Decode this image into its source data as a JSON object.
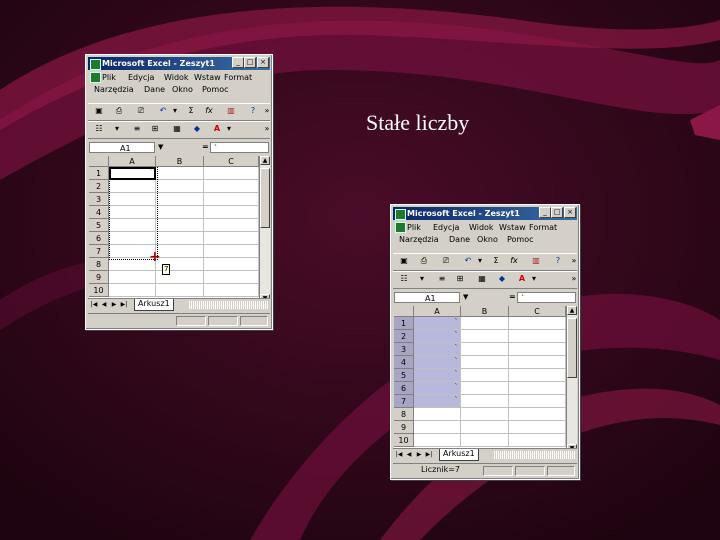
{
  "slide": {
    "title": "Stałe liczby"
  },
  "colors": {
    "background": "#2a0616",
    "swoosh": "#8a1745",
    "selection": "#b8b8dc",
    "titlebar": "#0a246a"
  },
  "excel": {
    "title": "Microsoft Excel - Zeszyt1",
    "menu_row1": [
      "Plik",
      "Edycja",
      "Widok",
      "Wstaw",
      "Format"
    ],
    "menu_row2": [
      "Narzędzia",
      "Dane",
      "Okno",
      "Pomoc"
    ],
    "name_box": "A1",
    "formula_mark": "=",
    "formula_value": "`",
    "columns": [
      "A",
      "B",
      "C"
    ],
    "rows": [
      "1",
      "2",
      "3",
      "4",
      "5",
      "6",
      "7",
      "8",
      "9",
      "10"
    ],
    "sheet_tab": "Arkusz1"
  },
  "window1": {
    "cell_values": [
      "`"
    ],
    "tooltip": "7"
  },
  "window2": {
    "cell_values": [
      "`",
      "`",
      "`",
      "`",
      "`",
      "`",
      "`"
    ],
    "status": "Licznik=7"
  }
}
